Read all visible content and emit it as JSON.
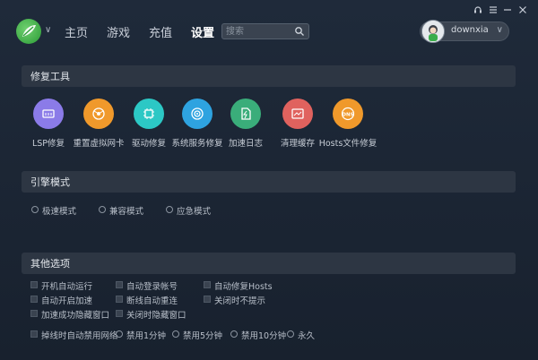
{
  "header": {
    "nav": [
      {
        "label": "主页",
        "active": false
      },
      {
        "label": "游戏",
        "active": false
      },
      {
        "label": "充值",
        "active": false
      },
      {
        "label": "设置",
        "active": true
      }
    ],
    "search_placeholder": "搜索",
    "username": "downxia"
  },
  "repair": {
    "title": "修复工具",
    "tools": [
      {
        "label": "LSP修复",
        "color": "#8b7be8",
        "icon": "lsp-icon"
      },
      {
        "label": "重置虚拟网卡",
        "color": "#f0992b",
        "icon": "network-card-icon"
      },
      {
        "label": "驱动修复",
        "color": "#2cc8c5",
        "icon": "chip-icon"
      },
      {
        "label": "系统服务修复",
        "color": "#2ea3e0",
        "icon": "service-icon"
      },
      {
        "label": "加速日志",
        "color": "#3aad7a",
        "icon": "log-icon"
      },
      {
        "label": "清理缓存",
        "color": "#e0625e",
        "icon": "cache-icon"
      },
      {
        "label": "Hosts文件修复",
        "color": "#f0992b",
        "icon": "dns-icon"
      }
    ]
  },
  "engine": {
    "title": "引擎模式",
    "modes": [
      "极速模式",
      "兼容模式",
      "应急模式"
    ]
  },
  "other": {
    "title": "其他选项",
    "options": [
      [
        "开机自动运行",
        "自动登录帐号",
        "自动修复Hosts"
      ],
      [
        "自动开启加速",
        "断线自动重连",
        "关闭时不提示"
      ],
      [
        "加速成功隐藏窗口",
        "关闭时隐藏窗口"
      ]
    ],
    "disconnect_label": "掉线时自动禁用网络",
    "disable_options": [
      "禁用1分钟",
      "禁用5分钟",
      "禁用10分钟",
      "永久"
    ]
  }
}
